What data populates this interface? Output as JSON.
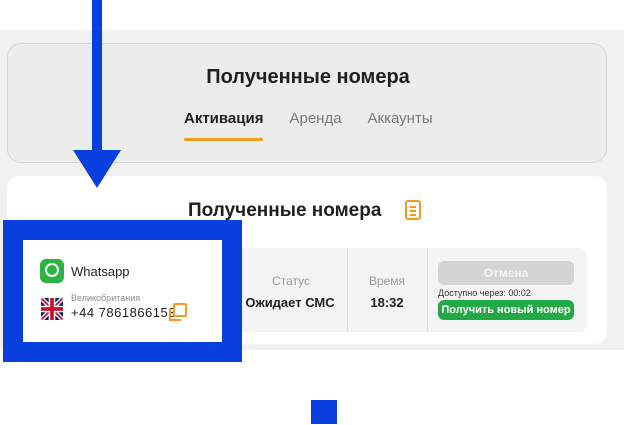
{
  "header": {
    "title": "Полученные номера",
    "tabs": [
      {
        "label": "Активация",
        "active": true
      },
      {
        "label": "Аренда",
        "active": false
      },
      {
        "label": "Аккаунты",
        "active": false
      }
    ]
  },
  "main": {
    "title": "Полученные номера",
    "order": {
      "service": "Whatsapp",
      "service_icon": "whatsapp-icon",
      "country": "Великобритания",
      "country_icon": "uk-flag-icon",
      "phone": "+44 7861866153",
      "status_label": "Статус",
      "status_value": "Ожидает СМС",
      "time_label": "Время",
      "time_value": "18:32",
      "cancel_label": "Отмена",
      "available_text": "Доступно через: 00:02",
      "new_number_label": "Получить новый номер"
    }
  },
  "colors": {
    "accent": "#f39a1f",
    "success": "#22a946",
    "overlay_blue": "#0a3fdf"
  }
}
